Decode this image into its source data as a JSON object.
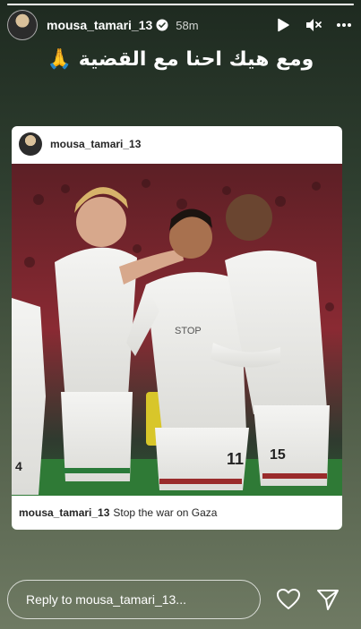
{
  "story": {
    "progress": 1.0,
    "username": "mousa_tamari_13",
    "time_ago": "58m",
    "caption": "ومع هيك احنا مع القضية 🙏"
  },
  "shared_post": {
    "username": "mousa_tamari_13",
    "caption_user": "mousa_tamari_13",
    "caption_text": "Stop the war on Gaza",
    "jersey_numbers": [
      "4",
      "11",
      "15"
    ],
    "shirt_text": "STOP"
  },
  "reply": {
    "placeholder": "Reply to mousa_tamari_13..."
  },
  "icons": {
    "verified": "verified-badge-icon",
    "play": "play-icon",
    "mute": "mute-icon",
    "more": "more-options-icon",
    "like": "heart-icon",
    "send": "send-icon"
  }
}
